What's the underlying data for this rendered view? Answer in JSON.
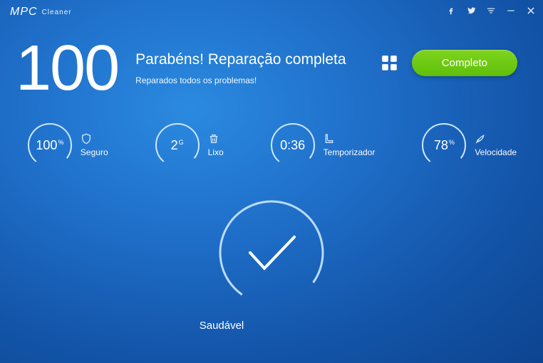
{
  "app": {
    "logo": "MPC",
    "sub": "Cleaner"
  },
  "header": {
    "score": "100",
    "title": "Parabéns! Reparação completa",
    "subtitle": "Reparados todos os problemas!",
    "complete_btn": "Completo"
  },
  "stats": {
    "secure": {
      "value": "100",
      "unit": "%",
      "label": "Seguro"
    },
    "junk": {
      "value": "2",
      "unit": "G",
      "label": "Lixo"
    },
    "timer": {
      "value": "0:36",
      "unit": "",
      "label": "Temporizador"
    },
    "speed": {
      "value": "78",
      "unit": "%",
      "label": "Velocidade"
    }
  },
  "health": {
    "label": "Saudável"
  }
}
